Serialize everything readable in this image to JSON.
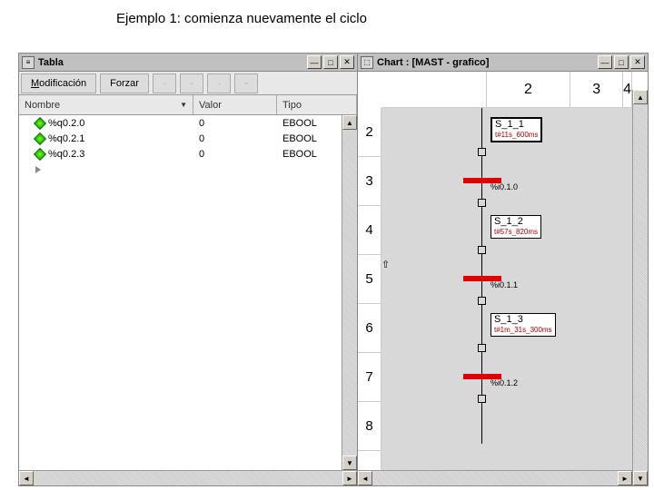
{
  "title": "Ejemplo 1:  comienza nuevamente el ciclo",
  "tabla": {
    "window_title": "Tabla",
    "toolbar": {
      "modificacion": "Modificación",
      "forzar": "Forzar"
    },
    "headers": {
      "nombre": "Nombre",
      "valor": "Valor",
      "tipo": "Tipo"
    },
    "rows": [
      {
        "name": "%q0.2.0",
        "value": "0",
        "type": "EBOOL"
      },
      {
        "name": "%q0.2.1",
        "value": "0",
        "type": "EBOOL"
      },
      {
        "name": "%q0.2.3",
        "value": "0",
        "type": "EBOOL"
      }
    ]
  },
  "chart": {
    "window_title": "Chart : [MAST - grafico]",
    "top_ruler": [
      "",
      "2",
      "3",
      "4"
    ],
    "left_ruler": [
      "2",
      "3",
      "4",
      "5",
      "6",
      "7",
      "8"
    ],
    "steps": [
      {
        "id": "S_1_1",
        "time": "t#11s_600ms",
        "active": true
      },
      {
        "id": "S_1_2",
        "time": "t#57s_820ms",
        "active": false
      },
      {
        "id": "S_1_3",
        "time": "t#1m_31s_300ms",
        "active": false
      }
    ],
    "transitions": [
      "%i0.1.0",
      "%i0.1.1",
      "%i0.1.2"
    ]
  }
}
